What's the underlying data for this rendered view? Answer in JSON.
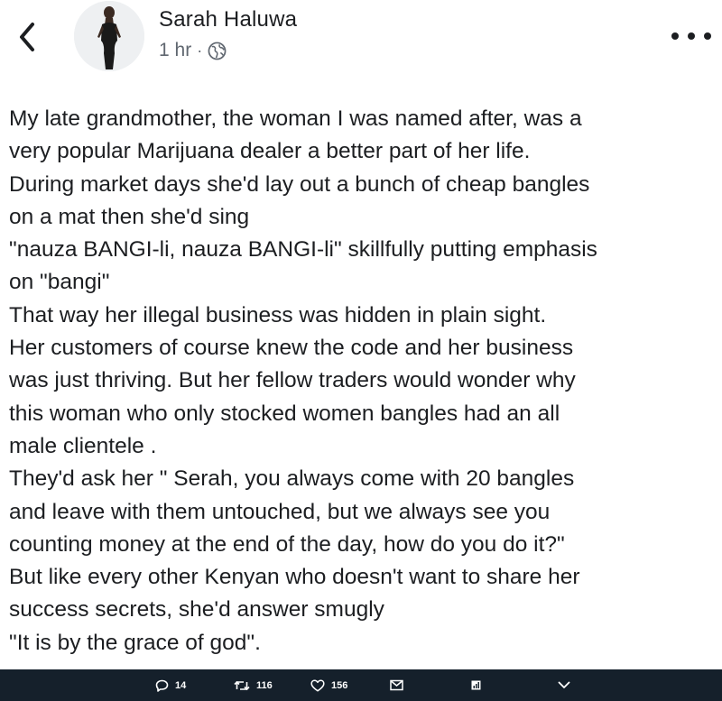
{
  "post": {
    "author": "Sarah Haluwa",
    "time": "1 hr",
    "separator": "·",
    "privacy_icon": "globe-icon",
    "lines": [
      "My late grandmother, the woman I was named after,  was a",
      "very popular Marijuana dealer a better part of her life.",
      "During market days she'd lay out a bunch of cheap bangles",
      "on a mat then she'd sing",
      "\"nauza BANGI-li, nauza BANGI-li\" skillfully putting emphasis",
      "on \"bangi\"",
      "That way her illegal business was hidden in plain sight.",
      "Her customers of course knew the code and her business",
      "was just thriving. But her fellow traders  would wonder why",
      "this woman who only stocked women bangles had an all",
      "male clientele .",
      "They'd ask her \" Serah,  you always come with 20 bangles",
      "and leave with them untouched, but we always see you",
      "counting money at the end of the day, how do you do it?\"",
      "But like every other Kenyan who doesn't want to share her",
      "success secrets, she'd answer smugly",
      "\"It is by the grace of god\"."
    ]
  },
  "header": {
    "back_icon": "chevron-left-icon",
    "more_icon": "more-dots-icon"
  },
  "actions": {
    "replies": "14",
    "retweets": "116",
    "likes": "156"
  },
  "colors": {
    "text": "#1c1e21",
    "meta": "#606770",
    "action_bar_bg": "#15202b"
  }
}
